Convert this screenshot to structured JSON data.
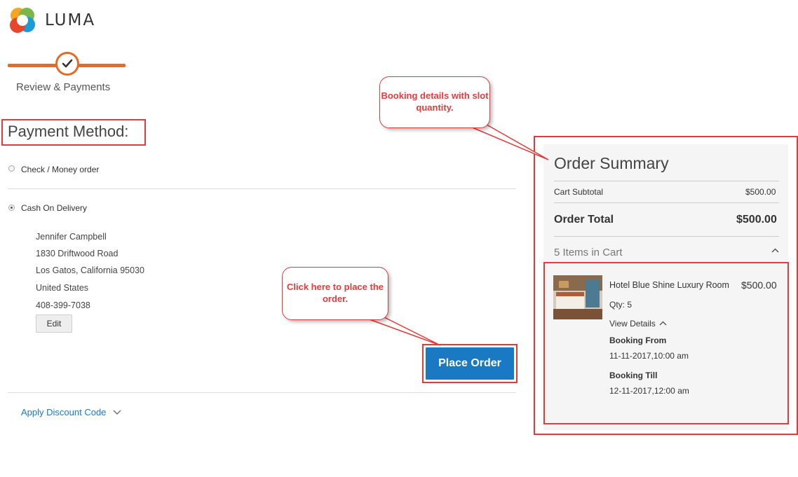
{
  "brand": {
    "name": "LUMA"
  },
  "progress": {
    "step_label": "Review & Payments"
  },
  "payment": {
    "title": "Payment Method:",
    "options": [
      {
        "label": "Check / Money order",
        "selected": false
      },
      {
        "label": "Cash On Delivery",
        "selected": true
      }
    ],
    "address": {
      "name": "Jennifer Campbell",
      "street": "1830 Driftwood Road",
      "city_line": "Los Gatos, California 95030",
      "country": "United States",
      "phone": "408-399-7038"
    },
    "edit_label": "Edit",
    "place_order_label": "Place Order",
    "discount_label": "Apply Discount Code"
  },
  "summary": {
    "title": "Order Summary",
    "subtotal_label": "Cart Subtotal",
    "subtotal_value": "$500.00",
    "total_label": "Order Total",
    "total_value": "$500.00",
    "items_in_cart": "5 Items in Cart",
    "item": {
      "name": "Hotel Blue Shine Luxury Room",
      "price": "$500.00",
      "qty": "Qty: 5",
      "view_details": "View Details",
      "booking_from_label": "Booking From",
      "booking_from_value": "11-11-2017,10:00 am",
      "booking_till_label": "Booking Till",
      "booking_till_value": "12-11-2017,12:00 am"
    }
  },
  "annotations": {
    "booking_callout": "Booking details with slot quantity.",
    "order_callout": "Click here to place the order."
  },
  "colors": {
    "accent": "#1979c3",
    "progress": "#e46a26",
    "annotation": "#e23b3b"
  }
}
